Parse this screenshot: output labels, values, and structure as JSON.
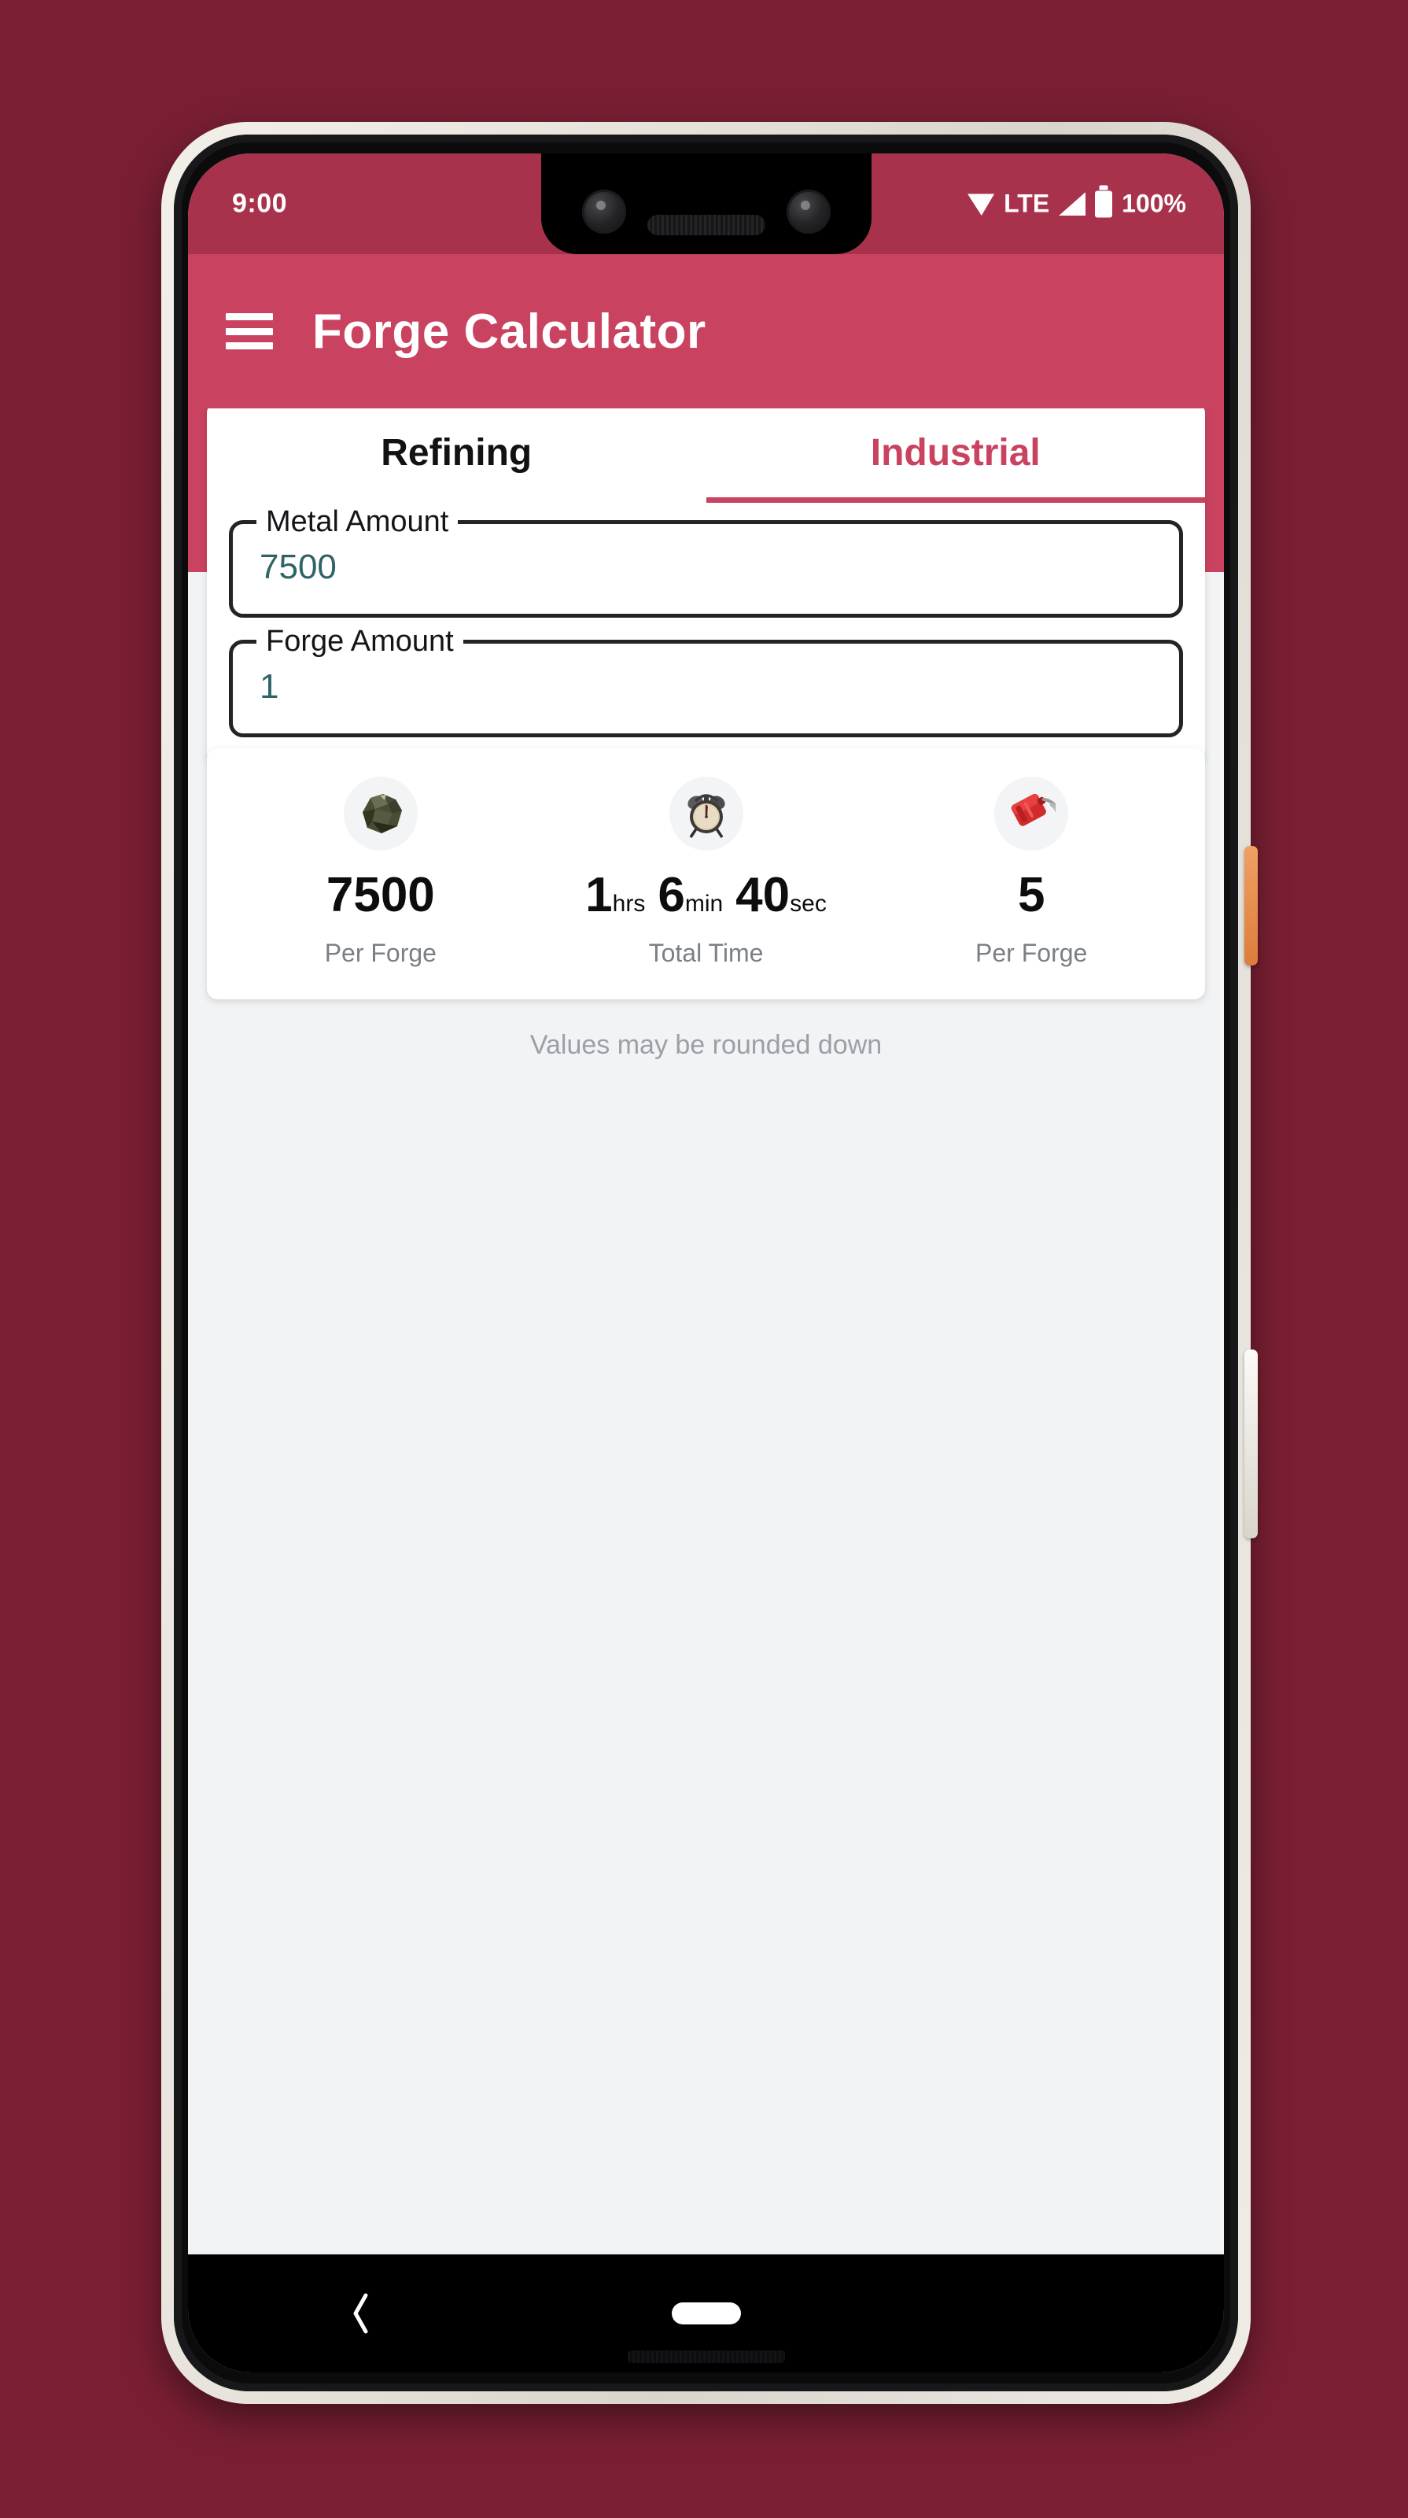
{
  "status_bar": {
    "time": "9:00",
    "network_label": "LTE",
    "battery_label": "100%",
    "icons": [
      "wifi-icon",
      "signal-icon",
      "battery-icon"
    ]
  },
  "app_bar": {
    "menu_icon": "hamburger-menu-icon",
    "title": "Forge Calculator"
  },
  "tabs": [
    {
      "label": "Refining",
      "active": false
    },
    {
      "label": "Industrial",
      "active": true
    }
  ],
  "inputs": [
    {
      "label": "Metal Amount",
      "value": "7500"
    },
    {
      "label": "Forge Amount",
      "value": "1"
    }
  ],
  "results": [
    {
      "icon": "ore-rock-icon",
      "value": "7500",
      "label": "Per Forge"
    },
    {
      "icon": "alarm-clock-icon",
      "segments": [
        {
          "num": "1",
          "unit": "hrs"
        },
        {
          "num": "6",
          "unit": "min"
        },
        {
          "num": "40",
          "unit": "sec"
        }
      ],
      "label": "Total Time"
    },
    {
      "icon": "fuel-can-icon",
      "value": "5",
      "label": "Per Forge"
    }
  ],
  "footnote": "Values may be rounded down",
  "nav_bar": {
    "back_icon": "back-chevron-icon",
    "home_icon": "home-pill-icon"
  },
  "colors": {
    "page_background": "#7a1f33",
    "status_bar": "#a8314b",
    "app_bar": "#c94360",
    "accent": "#c94360",
    "input_value": "#2e6368",
    "surface": "#ffffff",
    "scaffold": "#f2f3f5",
    "muted_text": "#7b7f86",
    "footnote_text": "#9ba0a7"
  }
}
